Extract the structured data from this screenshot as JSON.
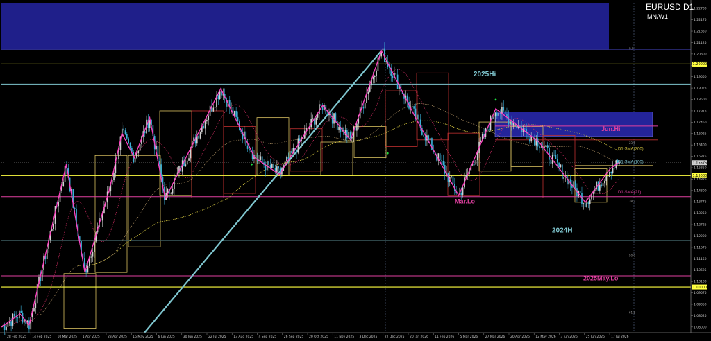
{
  "chart_data": {
    "type": "candlestick",
    "symbol_label": "EURUSD D1",
    "timeframes_label": "MN/W1",
    "x_ticks": [
      "28 Feb 2025",
      "14 Feb 2025",
      "10 Mar 2025",
      "1 Apr 2025",
      "23 Apr 2025",
      "15 May 2025",
      "6 Jun 2025",
      "30 Jun 2025",
      "22 Jul 2025",
      "13 Aug 2025",
      "4 Sep 2025",
      "26 Sep 2025",
      "20 Oct 2025",
      "11 Nov 2025",
      "3 Dec 2025",
      "22 Dec 2025",
      "20 Jan 2026",
      "11 Feb 2026",
      "5 Mar 2026",
      "27 Mar 2026",
      "20 Apr 2026",
      "12 May 2026",
      "3 Jun 2026",
      "25 Jun 2026",
      "17 Jul 2026"
    ],
    "y_ticks": [
      "1.22700",
      "1.22175",
      "1.21650",
      "1.21125",
      "1.20600",
      "1.20075",
      "1.19550",
      "1.19025",
      "1.18500",
      "1.17975",
      "1.17450",
      "1.16925",
      "1.16400",
      "1.15875",
      "1.15350",
      "1.14825",
      "1.14300",
      "1.13775",
      "1.13250",
      "1.12725",
      "1.12200",
      "1.11675",
      "1.11150",
      "1.10625",
      "1.10100",
      "1.09575",
      "1.09050",
      "1.08525",
      "1.08000"
    ],
    "ylim": [
      1.0795,
      1.2275
    ],
    "current_price": "1.15575",
    "price_tags": [
      "1.20000",
      "1.15000",
      "1.10000"
    ],
    "levels": [
      {
        "label": "2025Hi",
        "price": 1.191,
        "color": "#7fc6cf"
      },
      {
        "label": "Jun.Hi",
        "price": 1.1722,
        "color": "#e040a0"
      },
      {
        "label": "Mar.Lo",
        "price": 1.1405,
        "color": "#e040a0"
      },
      {
        "label": "2024H",
        "price": 1.121,
        "color": "#7fc6cf"
      },
      {
        "label": "2025May.Lo",
        "price": 1.105,
        "color": "#e040a0"
      },
      {
        "label": "",
        "price": 1.2,
        "color": "#ffff40"
      },
      {
        "label": "",
        "price": 1.15,
        "color": "#ffff40"
      },
      {
        "label": "",
        "price": 1.1,
        "color": "#ffff40"
      }
    ],
    "indicators": [
      {
        "name": "D1-SMA(200)",
        "color": "#d4c640"
      },
      {
        "name": "D1-SMA(100)",
        "color": "#7fc6cf"
      },
      {
        "name": "D1-SMA(21)",
        "color": "#e040a0"
      }
    ],
    "fib_labels": [
      "0.0",
      "23.6",
      "38.2",
      "50.0",
      "61.8"
    ],
    "swing_points": [
      {
        "t": 0.0,
        "p": 1.082
      },
      {
        "t": 0.03,
        "p": 1.088
      },
      {
        "t": 0.045,
        "p": 1.083
      },
      {
        "t": 0.105,
        "p": 1.155
      },
      {
        "t": 0.135,
        "p": 1.1065
      },
      {
        "t": 0.175,
        "p": 1.144
      },
      {
        "t": 0.195,
        "p": 1.169
      },
      {
        "t": 0.215,
        "p": 1.158
      },
      {
        "t": 0.24,
        "p": 1.176
      },
      {
        "t": 0.265,
        "p": 1.1395
      },
      {
        "t": 0.355,
        "p": 1.189
      },
      {
        "t": 0.41,
        "p": 1.158
      },
      {
        "t": 0.45,
        "p": 1.1505
      },
      {
        "t": 0.52,
        "p": 1.1815
      },
      {
        "t": 0.565,
        "p": 1.166
      },
      {
        "t": 0.615,
        "p": 1.206
      },
      {
        "t": 0.67,
        "p": 1.176
      },
      {
        "t": 0.74,
        "p": 1.141
      },
      {
        "t": 0.8,
        "p": 1.18
      },
      {
        "t": 0.87,
        "p": 1.165
      },
      {
        "t": 0.945,
        "p": 1.138
      },
      {
        "t": 0.985,
        "p": 1.153
      },
      {
        "t": 1.0,
        "p": 1.156
      }
    ]
  }
}
